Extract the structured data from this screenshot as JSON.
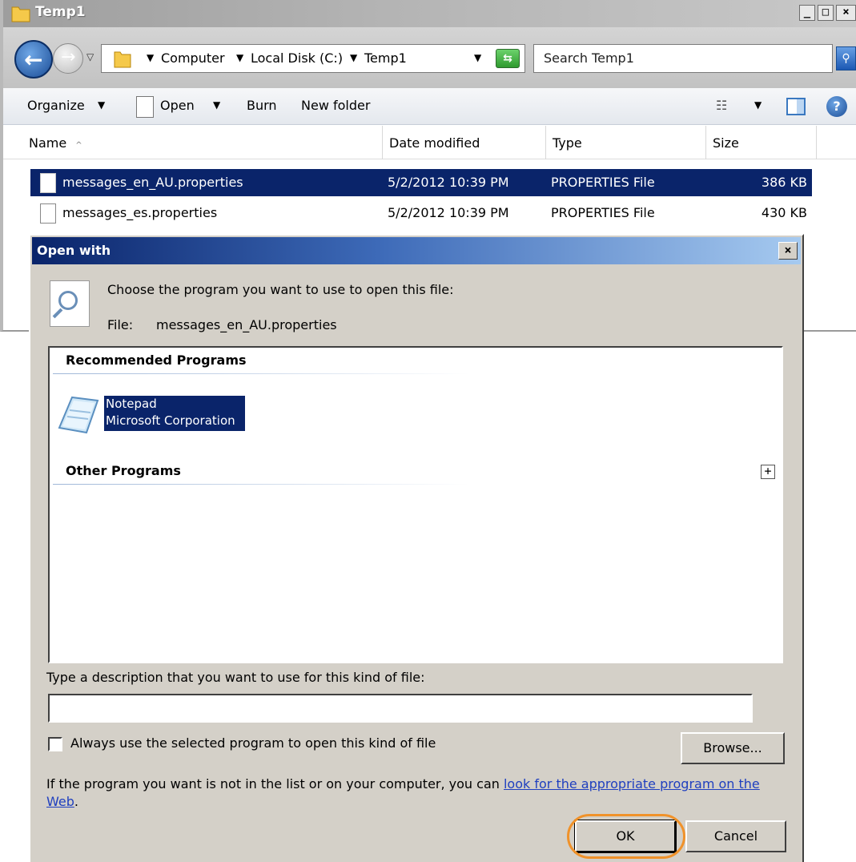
{
  "explorer": {
    "title": "Temp1",
    "caption_buttons": {
      "minimize": "_",
      "maximize": "□",
      "close": "×"
    },
    "address": {
      "crumbs": [
        "Computer",
        "Local Disk (C:)",
        "Temp1"
      ],
      "search_placeholder": "Search Temp1"
    },
    "commands": {
      "organize": "Organize",
      "open": "Open",
      "burn": "Burn",
      "new_folder": "New folder"
    },
    "columns": {
      "name": "Name",
      "date": "Date modified",
      "type": "Type",
      "size": "Size"
    },
    "files": [
      {
        "name": "messages_en_AU.properties",
        "date": "5/2/2012 10:39 PM",
        "type": "PROPERTIES File",
        "size": "386 KB",
        "selected": true
      },
      {
        "name": "messages_es.properties",
        "date": "5/2/2012 10:39 PM",
        "type": "PROPERTIES File",
        "size": "430 KB",
        "selected": false
      }
    ]
  },
  "dialog": {
    "title": "Open with",
    "close": "×",
    "prompt": "Choose the program you want to use to open this file:",
    "file_label": "File:",
    "file_name": "messages_en_AU.properties",
    "recommended_title": "Recommended Programs",
    "program": {
      "name": "Notepad",
      "vendor": "Microsoft Corporation"
    },
    "other_title": "Other Programs",
    "expand": "+",
    "description_label": "Type a description that you want to use for this kind of file:",
    "description_value": "",
    "always_label": "Always use the selected program to open this kind of file",
    "always_checked": false,
    "browse_label": "Browse...",
    "help_text": "If the program you want is not in the list or on your computer, you can ",
    "help_link": "look for the appropriate program on the Web",
    "help_end": ".",
    "ok_label": "OK",
    "cancel_label": "Cancel"
  },
  "colors": {
    "selection": "#0a246a",
    "dialog_face": "#d4d0c8",
    "highlight_ring": "#f0922a"
  }
}
